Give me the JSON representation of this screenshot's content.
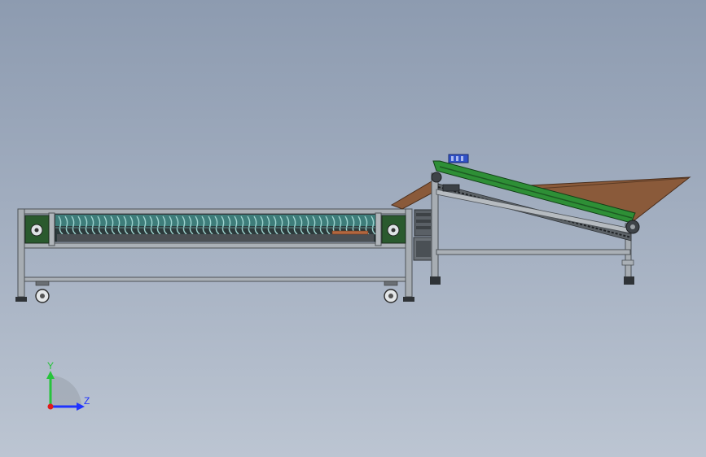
{
  "viewport": {
    "background_top": "#8d9bb0",
    "background_bottom": "#bcc5d2"
  },
  "triad": {
    "y_label": "Y",
    "z_label": "Z",
    "y_color": "#27c33c",
    "z_color": "#1f33ff",
    "x_color": "#e01b1b"
  },
  "colors": {
    "frame_steel": "#9ea3a8",
    "frame_edge": "#4d5257",
    "belt_green": "#2e8f36",
    "roller_teal": "#4d9e9a",
    "hopper_brown": "#8a5a3a",
    "sensor_blue": "#3152c8"
  }
}
